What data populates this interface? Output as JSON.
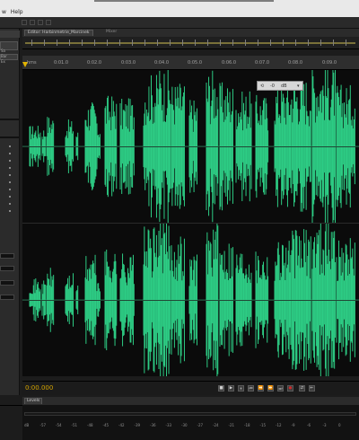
{
  "menubar": {
    "items": [
      "w",
      "Help"
    ]
  },
  "left_panel": {
    "lines": [
      "Sa",
      "Bar",
      "Ex"
    ]
  },
  "editor": {
    "tab_label": "Editor: Harbinmetrie_Marcinek",
    "secondary_tab": "Mixer"
  },
  "ruler": {
    "labels": [
      "hms",
      "0:01.0",
      "0:02.0",
      "0:03.0",
      "0:04.0",
      "0:05.0",
      "0:06.0",
      "0:07.0",
      "0:08.0",
      "0:09.0"
    ]
  },
  "hud": {
    "value": "-0",
    "unit": "dB"
  },
  "transport": {
    "timecode": "0:00.000",
    "buttons": [
      "■",
      "▶",
      "⏸",
      "⏮",
      "⏪",
      "⏩",
      "⏭",
      "●",
      "⇄",
      "⇤"
    ]
  },
  "levels": {
    "tab_label": "Levels",
    "scale": [
      "dB",
      "-57",
      "-54",
      "-51",
      "-48",
      "-45",
      "-42",
      "-39",
      "-36",
      "-33",
      "-30",
      "-27",
      "-24",
      "-21",
      "-18",
      "-15",
      "-12",
      "-9",
      "-6",
      "-3",
      "0"
    ]
  },
  "colors": {
    "waveform": "#2fd58a",
    "timecode": "#d4a400",
    "record": "#cc2b2b"
  }
}
